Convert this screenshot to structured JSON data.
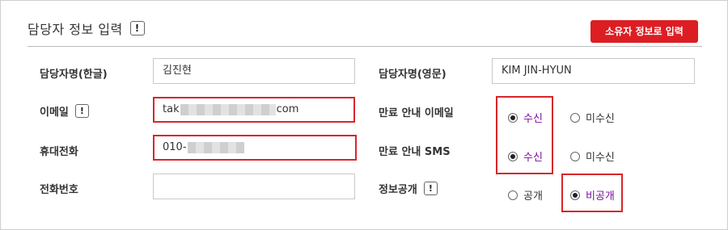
{
  "section": {
    "title": "담당자 정보 입력",
    "info_icon": "!"
  },
  "owner_button": {
    "label": "소유자 정보로 입력"
  },
  "fields": {
    "name_ko": {
      "label": "담당자명(한글)",
      "value": "김진현"
    },
    "name_en": {
      "label": "담당자명(영문)",
      "value": "KIM JIN-HYUN"
    },
    "email": {
      "label": "이메일",
      "info_icon": "!",
      "value_prefix": "tak",
      "value_suffix": "com"
    },
    "mobile": {
      "label": "휴대전화",
      "value_prefix": "010-"
    },
    "phone": {
      "label": "전화번호",
      "value": ""
    }
  },
  "options": {
    "expiry_email": {
      "label": "만료 안내 이메일",
      "opt_on": "수신",
      "opt_off": "미수신",
      "selected": "수신"
    },
    "expiry_sms": {
      "label": "만료 안내 SMS",
      "opt_on": "수신",
      "opt_off": "미수신",
      "selected": "수신"
    },
    "disclosure": {
      "label": "정보공개",
      "info_icon": "!",
      "opt_public": "공개",
      "opt_private": "비공개",
      "selected": "비공개"
    }
  },
  "colors": {
    "accent": "#dc1e23",
    "highlight_border": "#d8262b",
    "selected_text": "#7b0f9c"
  }
}
